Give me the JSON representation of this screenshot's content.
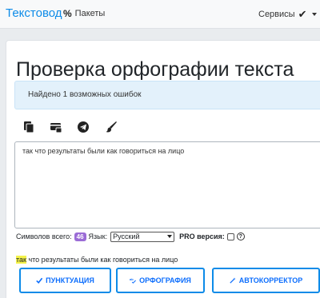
{
  "navbar": {
    "brand": "Текстовод",
    "packets_icon": "%",
    "packets_label": "Пакеты",
    "services_label": "Сервисы",
    "services_check": "✔"
  },
  "page": {
    "title": "Проверка орфографии текста",
    "alert": "Найдено 1 возможных ошибок"
  },
  "toolbar": {
    "icons": [
      "copy-icon",
      "card-icon",
      "telegram-icon",
      "brush-icon"
    ]
  },
  "editor": {
    "text": "так что результаты были как говориться на лицо"
  },
  "stats": {
    "chars_label": "Символов всего:",
    "chars_count": "46",
    "lang_label": "Язык:",
    "lang_value": "Русский",
    "pro_label": "PRO версия:",
    "help": "?"
  },
  "result": {
    "highlighted": "так",
    "rest": " что результаты были как говориться на лицо"
  },
  "buttons": {
    "punctuation": "ПУНКТУАЦИЯ",
    "spelling": "ОРФОГРАФИЯ",
    "autocorrect": "АВТОКОРРЕКТОР"
  },
  "colors": {
    "accent": "#0d8be8",
    "badge": "#9b6cd6",
    "highlight": "#f4f34a"
  }
}
